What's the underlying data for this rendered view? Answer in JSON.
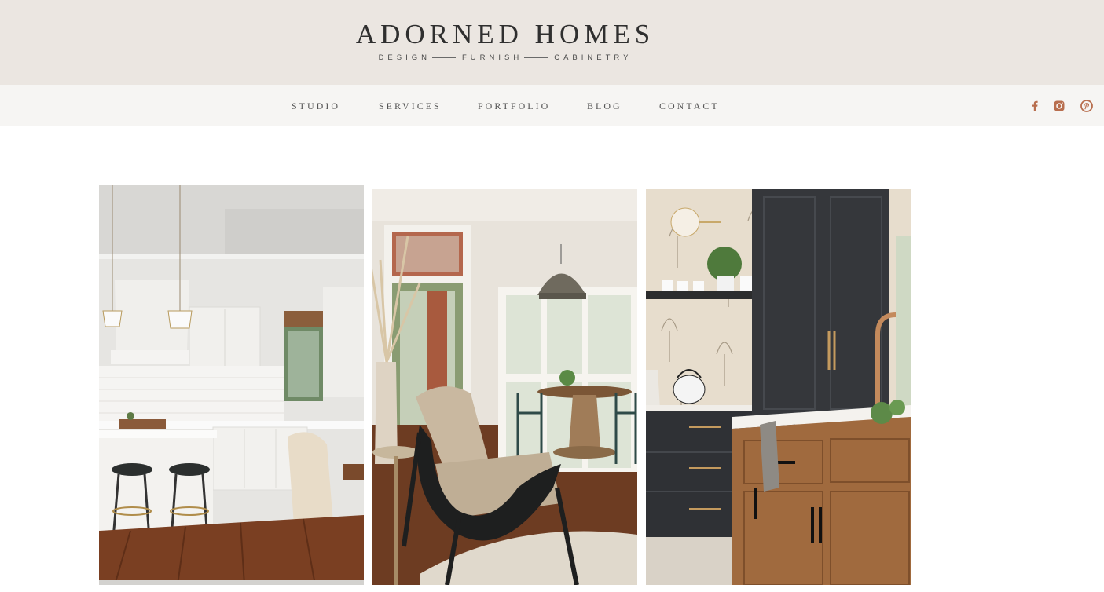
{
  "brand": {
    "name": "ADORNED HOMES",
    "tagline": [
      "DESIGN",
      "FURNISH",
      "CABINETRY"
    ]
  },
  "nav": {
    "items": [
      "STUDIO",
      "SERVICES",
      "PORTFOLIO",
      "BLOG",
      "CONTACT"
    ]
  },
  "social": [
    "facebook-icon",
    "instagram-icon",
    "pinterest-icon"
  ],
  "colors": {
    "header_bg": "#ebe6e1",
    "nav_bg": "#f6f5f3",
    "social_accent": "#b86e4e"
  },
  "gallery": [
    {
      "subject": "white kitchen with island, pendant lights and bar stools"
    },
    {
      "subject": "black lounge chair with pampas grass, dining area behind"
    },
    {
      "subject": "floral wallpaper, dark cabinetry and wood island with copper faucet"
    }
  ]
}
